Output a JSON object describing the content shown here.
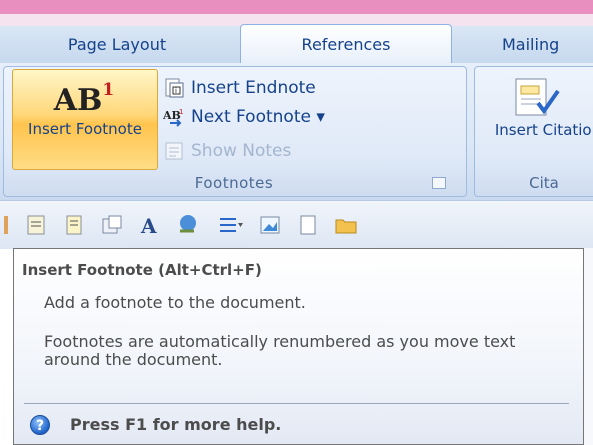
{
  "tabs": {
    "page_layout": "Page Layout",
    "references": "References",
    "mailings": "Mailing"
  },
  "footnotes_group": {
    "insert_footnote_label": "Insert Footnote",
    "ab_text": "AB",
    "ab_sup": "1",
    "insert_endnote": "Insert Endnote",
    "next_footnote": "Next Footnote ▾",
    "show_notes": "Show Notes",
    "group_label": "Footnotes"
  },
  "citations_group": {
    "insert_citation_label": "Insert Citation",
    "group_label": "Cita"
  },
  "tooltip": {
    "title": "Insert Footnote (Alt+Ctrl+F)",
    "body": "Add a footnote to the document.",
    "detail": "Footnotes are automatically renumbered as you move text around the document.",
    "help": "Press F1 for more help."
  },
  "colors": {
    "tab_text": "#15428b",
    "hover_button": "#ffc44d",
    "frame_pink": "#e88fc0"
  },
  "icons": [
    "insert-endnote-icon",
    "next-footnote-icon",
    "show-notes-icon",
    "dialog-launcher-icon",
    "citation-icon",
    "help-icon"
  ]
}
